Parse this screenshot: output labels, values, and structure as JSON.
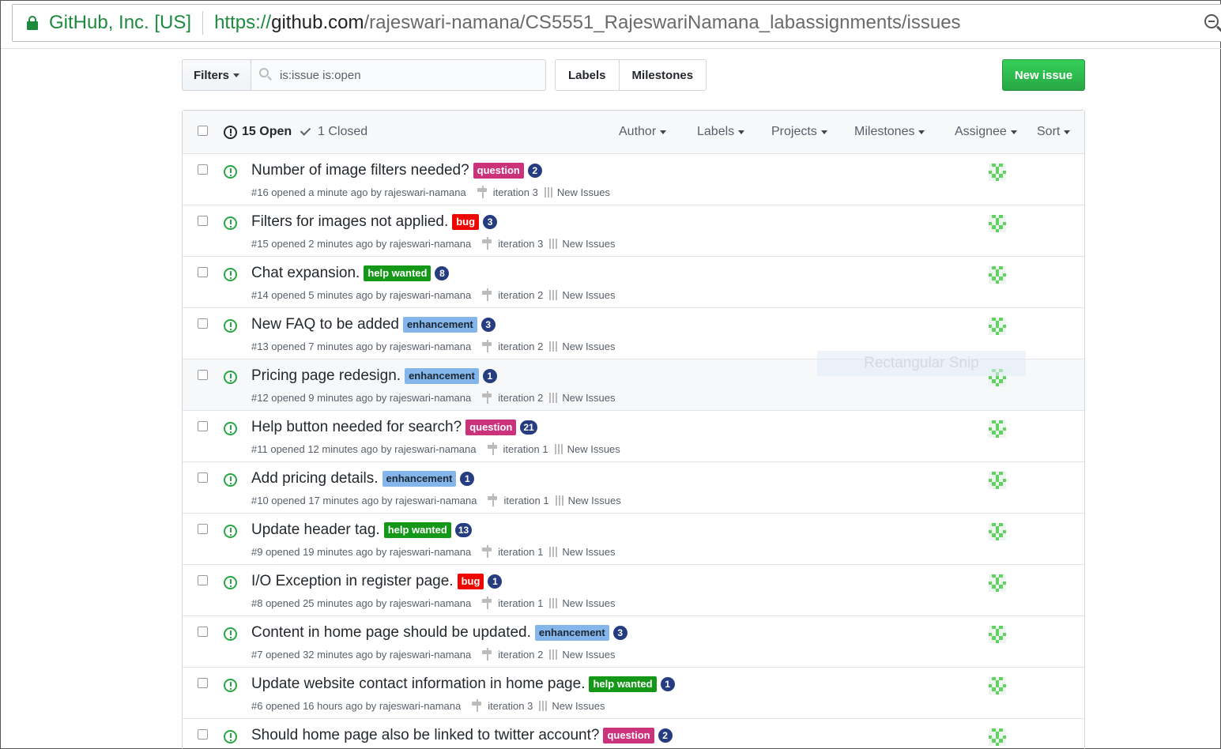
{
  "browser": {
    "site_identity": "GitHub, Inc. [US]",
    "url_protocol": "https://",
    "url_host": "github.com",
    "url_path": "/rajeswari-namana/CS5551_RajeswariNamana_labassignments/issues"
  },
  "toolbar": {
    "filters_label": "Filters",
    "search_value": "is:issue is:open",
    "labels_label": "Labels",
    "milestones_label": "Milestones",
    "new_issue_label": "New issue"
  },
  "header": {
    "open_label": "15 Open",
    "closed_label": "1 Closed",
    "menus": [
      "Author",
      "Labels",
      "Projects",
      "Milestones",
      "Assignee",
      "Sort"
    ]
  },
  "issues": [
    {
      "title": "Number of image filters needed?",
      "label": "question",
      "label_type": "question",
      "comments": "2",
      "meta": "#16 opened a minute ago by rajeswari-namana",
      "milestone": "iteration 3",
      "project": "New Issues"
    },
    {
      "title": "Filters for images not applied.",
      "label": "bug",
      "label_type": "bug",
      "comments": "3",
      "meta": "#15 opened 2 minutes ago by rajeswari-namana",
      "milestone": "iteration 3",
      "project": "New Issues"
    },
    {
      "title": "Chat expansion.",
      "label": "help wanted",
      "label_type": "help",
      "comments": "8",
      "meta": "#14 opened 5 minutes ago by rajeswari-namana",
      "milestone": "iteration 2",
      "project": "New Issues"
    },
    {
      "title": "New FAQ to be added",
      "label": "enhancement",
      "label_type": "enh",
      "comments": "3",
      "meta": "#13 opened 7 minutes ago by rajeswari-namana",
      "milestone": "iteration 2",
      "project": "New Issues"
    },
    {
      "title": "Pricing page redesign.",
      "label": "enhancement",
      "label_type": "enh",
      "comments": "1",
      "meta": "#12 opened 9 minutes ago by rajeswari-namana",
      "milestone": "iteration 2",
      "project": "New Issues"
    },
    {
      "title": "Help button needed for search?",
      "label": "question",
      "label_type": "question",
      "comments": "21",
      "meta": "#11 opened 12 minutes ago by rajeswari-namana",
      "milestone": "iteration 1",
      "project": "New Issues"
    },
    {
      "title": "Add pricing details.",
      "label": "enhancement",
      "label_type": "enh",
      "comments": "1",
      "meta": "#10 opened 17 minutes ago by rajeswari-namana",
      "milestone": "iteration 1",
      "project": "New Issues"
    },
    {
      "title": "Update header tag.",
      "label": "help wanted",
      "label_type": "help",
      "comments": "13",
      "meta": "#9 opened 19 minutes ago by rajeswari-namana",
      "milestone": "iteration 1",
      "project": "New Issues"
    },
    {
      "title": "I/O Exception in register page.",
      "label": "bug",
      "label_type": "bug",
      "comments": "1",
      "meta": "#8 opened 25 minutes ago by rajeswari-namana",
      "milestone": "iteration 1",
      "project": "New Issues"
    },
    {
      "title": "Content in home page should be updated.",
      "label": "enhancement",
      "label_type": "enh",
      "comments": "3",
      "meta": "#7 opened 32 minutes ago by rajeswari-namana",
      "milestone": "iteration 2",
      "project": "New Issues"
    },
    {
      "title": "Update website contact information in home page.",
      "label": "help wanted",
      "label_type": "help",
      "comments": "1",
      "meta": "#6 opened 16 hours ago by rajeswari-namana",
      "milestone": "iteration 3",
      "project": "New Issues"
    },
    {
      "title": "Should home page also be linked to twitter account?",
      "label": "question",
      "label_type": "question",
      "comments": "2",
      "meta": "",
      "milestone": "",
      "project": ""
    }
  ],
  "overlay": {
    "snip_text": "Rectangular Snip"
  }
}
